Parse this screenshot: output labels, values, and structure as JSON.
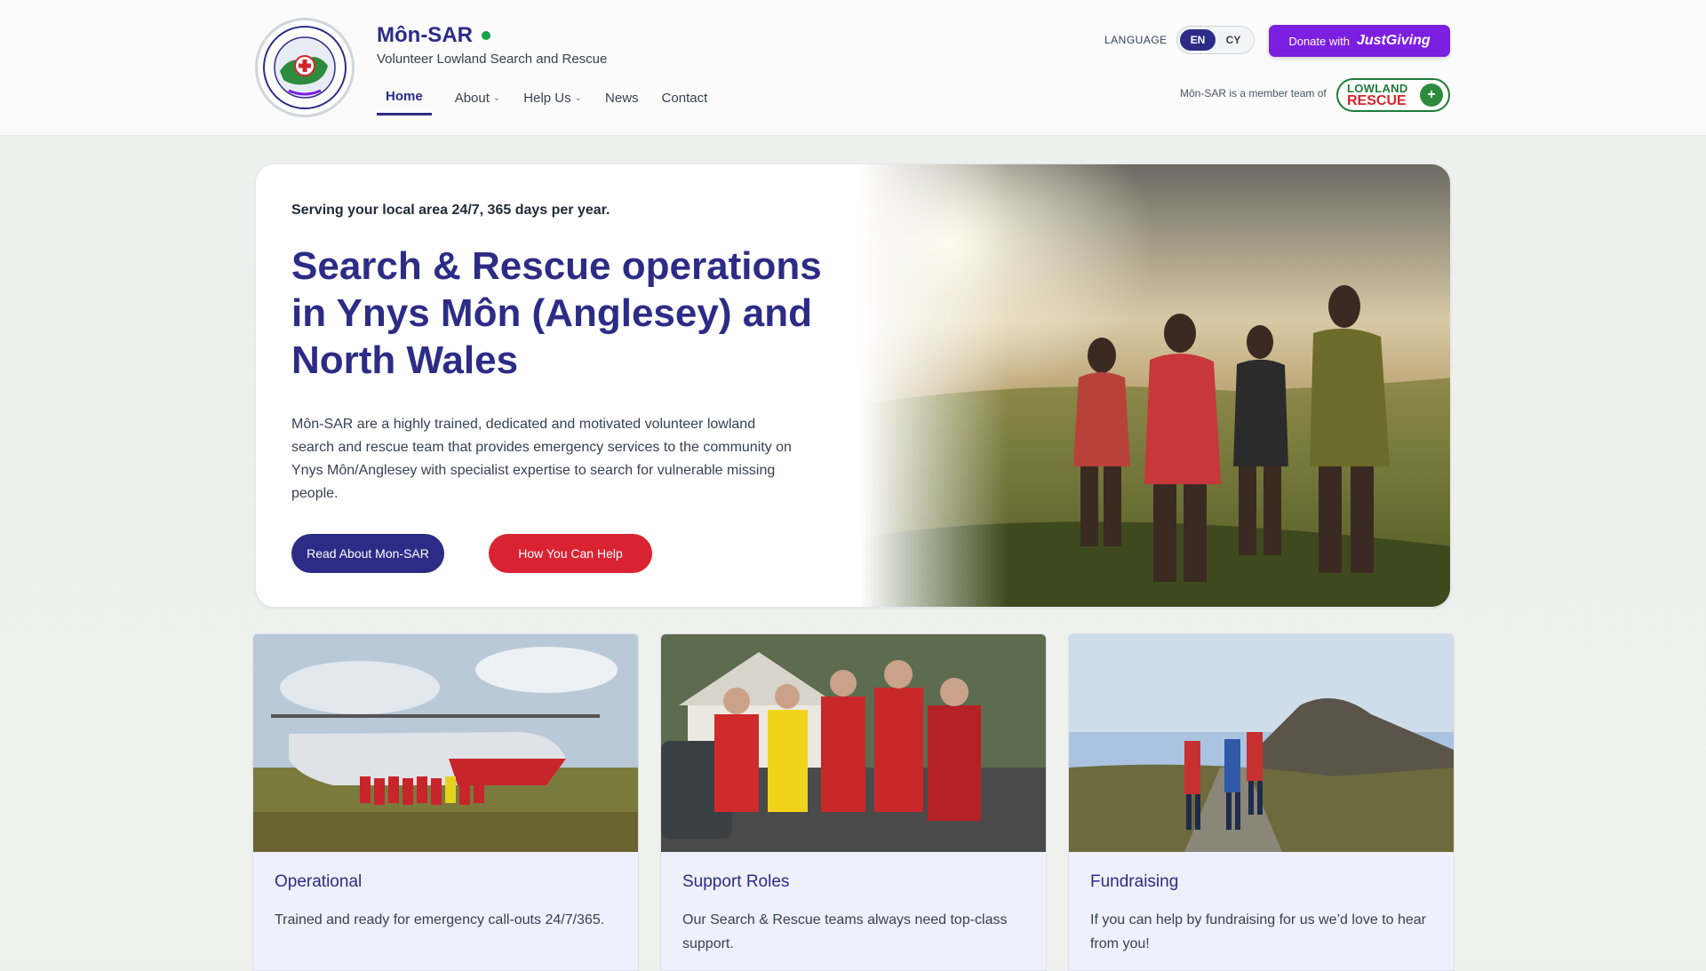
{
  "brand": {
    "name": "Môn-SAR",
    "tagline": "Volunteer Lowland Search and Rescue",
    "logo_text": "Môn-SAR"
  },
  "nav": {
    "items": [
      {
        "label": "Home",
        "active": true,
        "has_dropdown": false
      },
      {
        "label": "About",
        "active": false,
        "has_dropdown": true
      },
      {
        "label": "Help Us",
        "active": false,
        "has_dropdown": true
      },
      {
        "label": "News",
        "active": false,
        "has_dropdown": false
      },
      {
        "label": "Contact",
        "active": false,
        "has_dropdown": false
      }
    ]
  },
  "language": {
    "label": "LANGUAGE",
    "options": [
      "EN",
      "CY"
    ],
    "selected": "EN"
  },
  "donate": {
    "prefix": "Donate with",
    "brand": "JustGiving",
    "color": "#7b1fe0"
  },
  "membership": {
    "text": "Môn-SAR is a member team of",
    "partner_line1": "LOWLAND",
    "partner_line2": "RESCUE"
  },
  "hero": {
    "kicker": "Serving your local area 24/7, 365 days per year.",
    "title": "Search & Rescue operations in Ynys Môn (Anglesey) and North Wales",
    "body": "Môn-SAR are a highly trained, dedicated and motivated volunteer lowland search and rescue team that provides emergency services to the community on Ynys Môn/Anglesey with specialist expertise to search for vulnerable missing people.",
    "primary_button": "Read About Mon-SAR",
    "secondary_button": "How You Can Help"
  },
  "cards": [
    {
      "title": "Operational",
      "text": "Trained and ready for emergency call-outs 24/7/365."
    },
    {
      "title": "Support Roles",
      "text": "Our Search & Rescue teams always need top-class support."
    },
    {
      "title": "Fundraising",
      "text": "If you can help by fundraising for us we’d love to hear from you!"
    }
  ],
  "colors": {
    "brand_navy": "#2c2c86",
    "accent_red": "#d92332",
    "status_green": "#16a34a"
  }
}
